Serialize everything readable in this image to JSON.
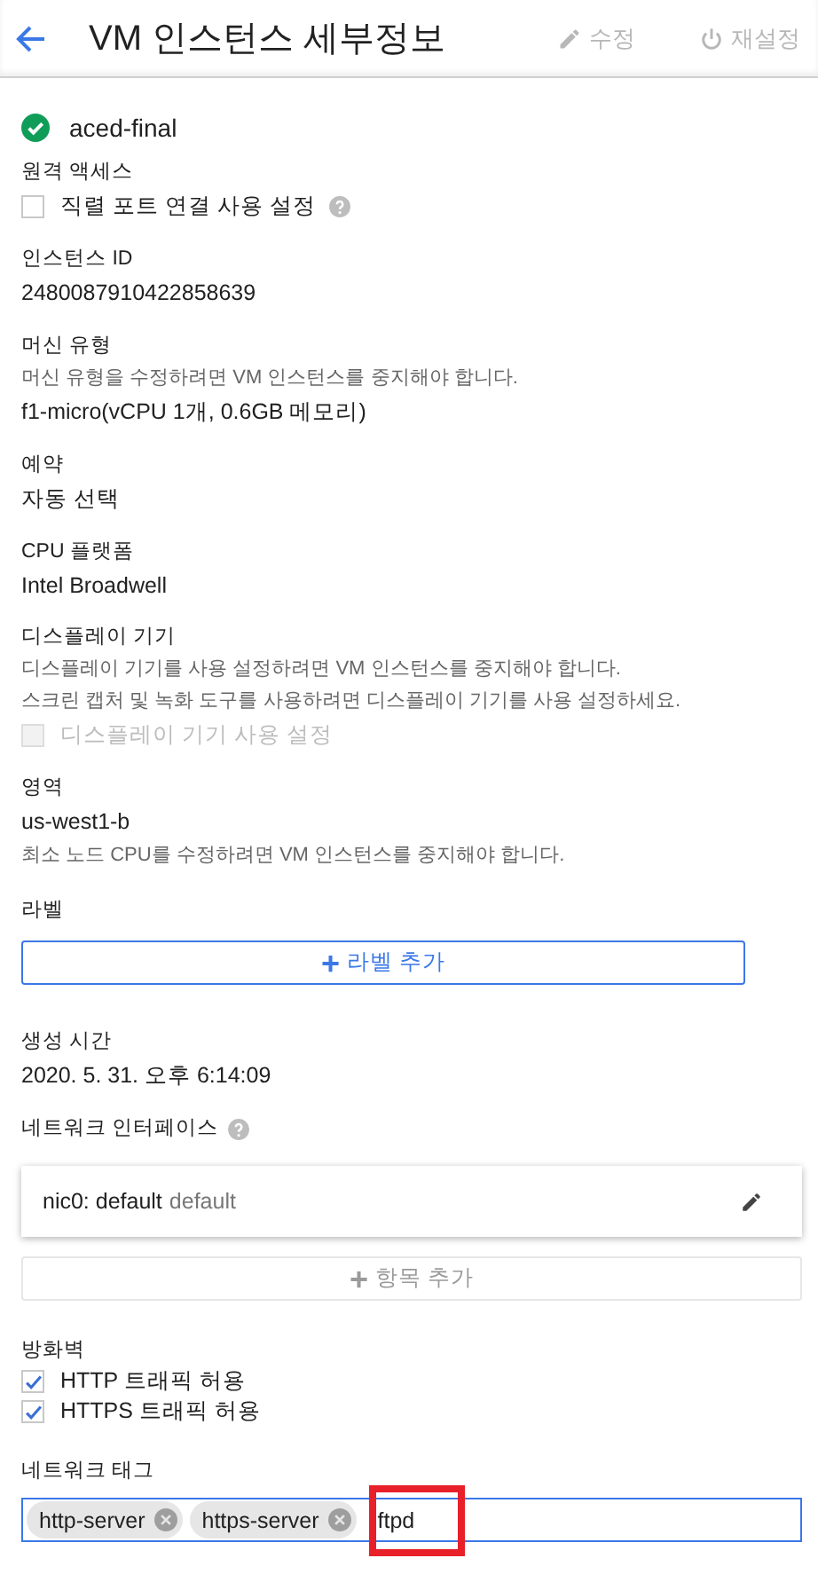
{
  "header": {
    "title": "VM 인스턴스 세부정보",
    "actions": [
      {
        "label": "수정",
        "kind": "edit",
        "disabled": true
      },
      {
        "label": "재설정",
        "kind": "reset",
        "disabled": true
      }
    ]
  },
  "instance": {
    "name": "aced-final",
    "status_ok": true
  },
  "remote_access": {
    "label": "원격 액세스",
    "checkbox": {
      "label": "직렬 포트 연결 사용 설정",
      "checked": false,
      "disabled": false
    }
  },
  "instance_id": {
    "label": "인스턴스 ID",
    "value": "2480087910422858639"
  },
  "machine_type": {
    "label": "머신 유형",
    "hint": "머신 유형을 수정하려면 VM 인스턴스를 중지해야 합니다.",
    "value": "f1-micro(vCPU 1개, 0.6GB 메모리)"
  },
  "reservation": {
    "label": "예약",
    "value": "자동 선택"
  },
  "cpu_platform": {
    "label": "CPU 플랫폼",
    "value": "Intel Broadwell"
  },
  "display": {
    "label": "디스플레이 기기",
    "hints": [
      "디스플레이 기기를 사용 설정하려면 VM 인스턴스를 중지해야 합니다.",
      "스크린 캡처 및 녹화 도구를 사용하려면 디스플레이 기기를 사용 설정하세요."
    ],
    "checkbox": {
      "label": "디스플레이 기기 사용 설정",
      "checked": false,
      "disabled": true
    }
  },
  "zone": {
    "label": "영역",
    "value": "us-west1-b",
    "hint": "최소 노드 CPU를 수정하려면 VM 인스턴스를 중지해야 합니다."
  },
  "labels": {
    "label": "라벨",
    "button": {
      "icon": "+",
      "label": "라벨 추가",
      "disabled": false
    }
  },
  "created": {
    "label": "생성 시간",
    "value": "2020. 5. 31. 오후 6:14:09"
  },
  "network_interfaces": {
    "label": "네트워크 인터페이스",
    "items": [
      {
        "name": "nic0: default",
        "network": "default"
      }
    ],
    "add_button": {
      "icon": "+",
      "label": "항목 추가",
      "disabled": true
    }
  },
  "firewall": {
    "label": "방화벽",
    "options": [
      {
        "label": "HTTP 트래픽 허용",
        "checked": true
      },
      {
        "label": "HTTPS 트래픽 허용",
        "checked": true
      }
    ]
  },
  "network_tags": {
    "label": "네트워크 태그",
    "tags": [
      "http-server",
      "https-server"
    ],
    "input": {
      "value": "ftpd",
      "highlighted": true
    }
  }
}
